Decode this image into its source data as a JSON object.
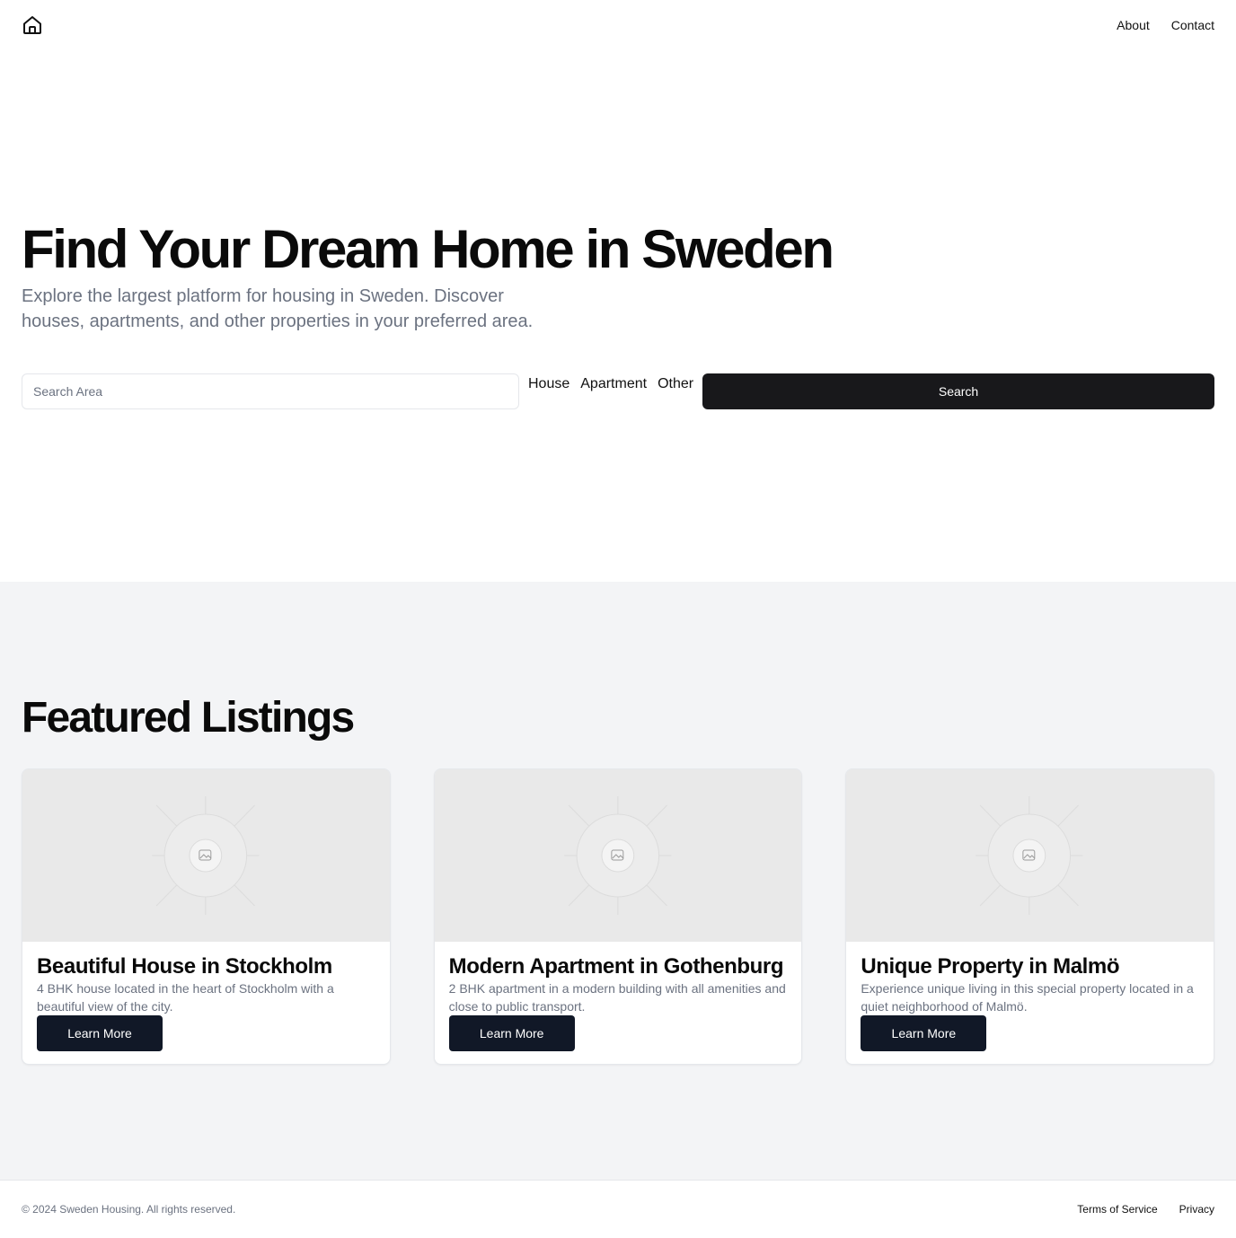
{
  "header": {
    "logo_icon": "home-icon",
    "nav": [
      {
        "label": "About"
      },
      {
        "label": "Contact"
      }
    ]
  },
  "hero": {
    "title": "Find Your Dream Home in Sweden",
    "subtitle": "Explore the largest platform for housing in Sweden. Discover houses, apartments, and other properties in your preferred area.",
    "search": {
      "placeholder": "Search Area",
      "value": ""
    },
    "types": [
      {
        "label": "House"
      },
      {
        "label": "Apartment"
      },
      {
        "label": "Other"
      }
    ],
    "search_button": "Search"
  },
  "featured": {
    "title": "Featured Listings",
    "listings": [
      {
        "title": "Beautiful House in Stockholm",
        "description": "4 BHK house located in the heart of Stockholm with a beautiful view of the city.",
        "button": "Learn More",
        "image_icon": "image-placeholder-icon"
      },
      {
        "title": "Modern Apartment in Gothenburg",
        "description": "2 BHK apartment in a modern building with all amenities and close to public transport.",
        "button": "Learn More",
        "image_icon": "image-placeholder-icon"
      },
      {
        "title": "Unique Property in Malmö",
        "description": "Experience unique living in this special property located in a quiet neighborhood of Malmö.",
        "button": "Learn More",
        "image_icon": "image-placeholder-icon"
      }
    ]
  },
  "footer": {
    "copyright": "© 2024 Sweden Housing. All rights reserved.",
    "links": [
      {
        "label": "Terms of Service"
      },
      {
        "label": "Privacy"
      }
    ]
  },
  "colors": {
    "primary_button": "#18181b",
    "card_button": "#111827",
    "muted_text": "#6b7280",
    "section_bg": "#f3f4f6",
    "image_bg": "#e9e9e9"
  }
}
